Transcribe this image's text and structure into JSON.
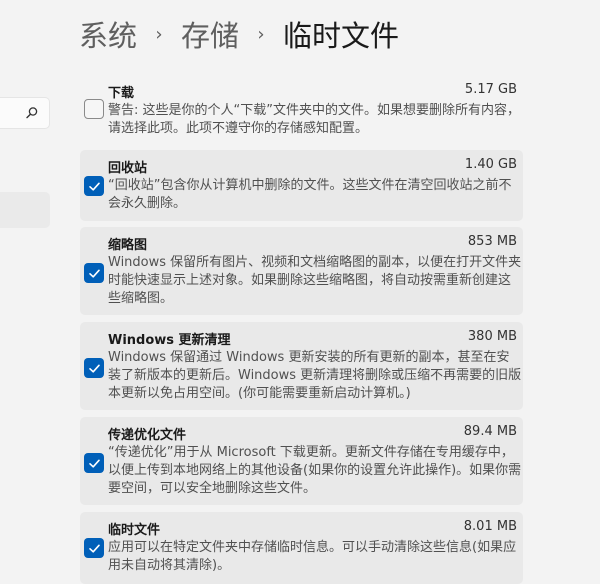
{
  "breadcrumb": {
    "item1": "系统",
    "item2": "存储",
    "current": "临时文件"
  },
  "items": [
    {
      "title": "下载",
      "size": "5.17 GB",
      "checked": false,
      "desc": "警告: 这些是你的个人“下载”文件夹中的文件。如果想要删除所有内容，请选择此项。此项不遵守你的存储感知配置。"
    },
    {
      "title": "回收站",
      "size": "1.40 GB",
      "checked": true,
      "desc": "“回收站”包含你从计算机中删除的文件。这些文件在清空回收站之前不会永久删除。"
    },
    {
      "title": "缩略图",
      "size": "853 MB",
      "checked": true,
      "desc": "Windows 保留所有图片、视频和文档缩略图的副本，以便在打开文件夹时能快速显示上述对象。如果删除这些缩略图，将自动按需重新创建这些缩略图。"
    },
    {
      "title": "Windows 更新清理",
      "size": "380 MB",
      "checked": true,
      "desc": "Windows 保留通过 Windows 更新安装的所有更新的副本，甚至在安装了新版本的更新后。Windows 更新清理将删除或压缩不再需要的旧版本更新以免占用空间。(你可能需要重新启动计算机。)"
    },
    {
      "title": "传递优化文件",
      "size": "89.4 MB",
      "checked": true,
      "desc": "“传递优化”用于从 Microsoft 下载更新。更新文件存储在专用缓存中，以便上传到本地网络上的其他设备(如果你的设置允许此操作)。如果你需要空间，可以安全地删除这些文件。"
    },
    {
      "title": "临时文件",
      "size": "8.01 MB",
      "checked": true,
      "desc": "应用可以在特定文件夹中存储临时信息。可以手动清除这些信息(如果应用未自动将其清除)。"
    }
  ]
}
